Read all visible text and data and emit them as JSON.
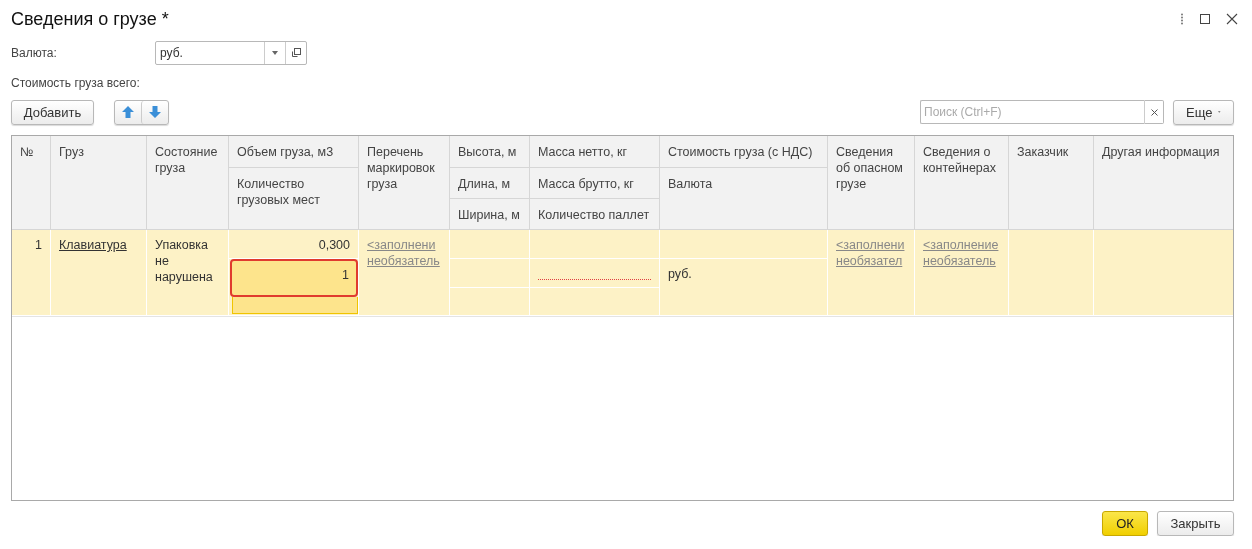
{
  "window": {
    "title": "Сведения о грузе *"
  },
  "currency": {
    "label": "Валюта:",
    "value": "руб."
  },
  "total_cost": {
    "label": "Стоимость груза всего:"
  },
  "toolbar": {
    "add_button": "Добавить",
    "search": {
      "placeholder": "Поиск (Ctrl+F)"
    },
    "more_button": "Еще"
  },
  "table": {
    "columns": [
      {
        "headers": [
          "№"
        ]
      },
      {
        "headers": [
          "Груз"
        ]
      },
      {
        "headers": [
          "Состояние груза"
        ]
      },
      {
        "headers": [
          "Объем груза, м3",
          "Количество грузовых мест"
        ]
      },
      {
        "headers": [
          "Перечень маркировок груза"
        ]
      },
      {
        "headers": [
          "Высота, м",
          "Длина, м",
          "Ширина, м"
        ]
      },
      {
        "headers": [
          "Масса нетто, кг",
          "Масса брутто, кг",
          "Количество паллет"
        ]
      },
      {
        "headers": [
          "Стоимость груза (с НДС)",
          "Валюта"
        ]
      },
      {
        "headers": [
          "Сведения об опасном грузе"
        ]
      },
      {
        "headers": [
          "Сведения о контейнерах"
        ]
      },
      {
        "headers": [
          "Заказчик"
        ]
      },
      {
        "headers": [
          "Другая информация"
        ]
      }
    ],
    "rows": [
      {
        "selected": true,
        "cells": [
          [
            {
              "kind": "number",
              "text": "1"
            }
          ],
          [
            {
              "kind": "link",
              "text": "Клавиатура"
            }
          ],
          [
            {
              "kind": "text",
              "text": "Упаковка не нарушена"
            }
          ],
          [
            {
              "kind": "number",
              "text": "0,300"
            },
            {
              "kind": "editing",
              "text": "1"
            }
          ],
          [
            {
              "kind": "hint",
              "text": "<заполнени необязатель"
            }
          ],
          [
            {
              "kind": "empty"
            },
            {
              "kind": "empty"
            },
            {
              "kind": "empty"
            }
          ],
          [
            {
              "kind": "empty"
            },
            {
              "kind": "required"
            },
            {
              "kind": "empty"
            }
          ],
          [
            {
              "kind": "empty"
            },
            {
              "kind": "text",
              "text": "руб."
            }
          ],
          [
            {
              "kind": "hint",
              "text": "<заполнени необязател"
            }
          ],
          [
            {
              "kind": "hint",
              "text": "<заполнение необязатель"
            }
          ],
          [
            {
              "kind": "empty"
            }
          ],
          [
            {
              "kind": "empty"
            }
          ]
        ]
      }
    ]
  },
  "footer": {
    "ok_button": "ОК",
    "close_button": "Закрыть"
  }
}
